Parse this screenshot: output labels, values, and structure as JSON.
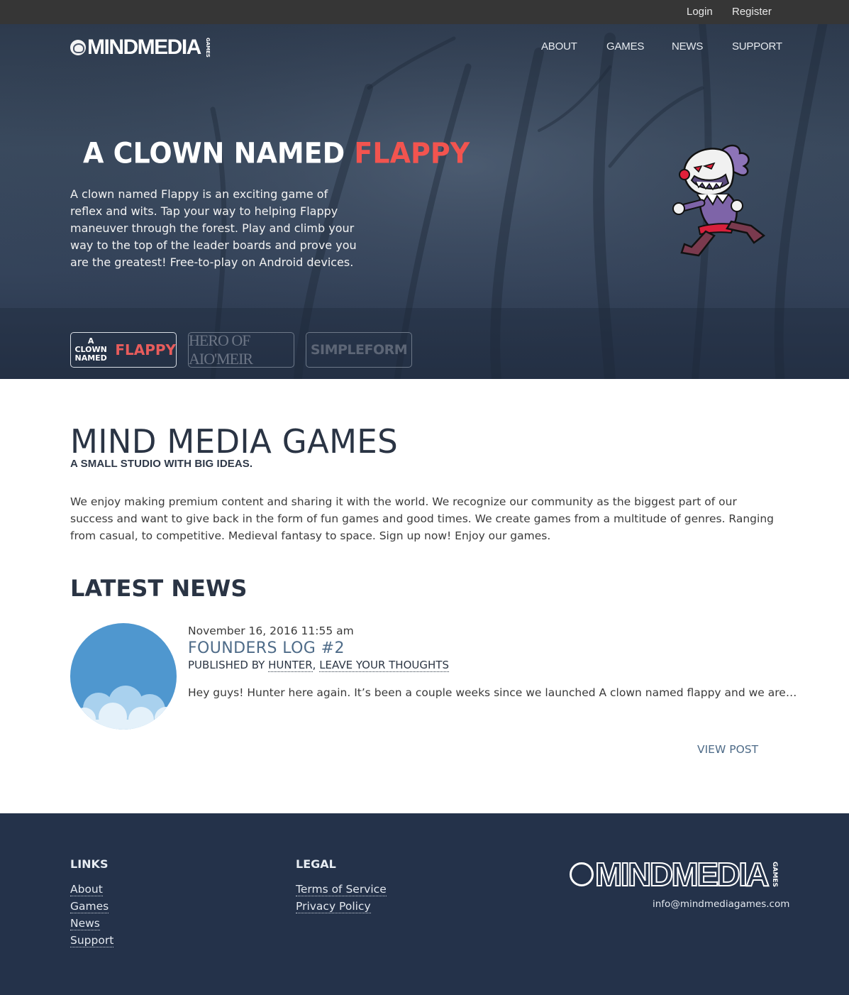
{
  "topbar": {
    "login": "Login",
    "register": "Register"
  },
  "brand": {
    "name": "MINDMEDIA",
    "suffix": "GAMES"
  },
  "nav": {
    "about": "ABOUT",
    "games": "GAMES",
    "news": "NEWS",
    "support": "SUPPORT"
  },
  "hero": {
    "title_main": "A CLOWN NAMED ",
    "title_accent": "FLAPPY",
    "description": "A clown named Flappy is an exciting game of reflex and wits. Tap your way to helping Flappy maneuver through the forest. Play and climb your way to the top of the leader boards and prove you are the greatest! Free-to-play on Android devices.",
    "thumbs": [
      {
        "line1": "A CLOWN",
        "line2": "NAMED",
        "accent": "FLAPPY",
        "active": true
      },
      {
        "label": "HERO OF AIO'MEIR",
        "active": false
      },
      {
        "label": "SIMPLEFORM",
        "active": false
      }
    ]
  },
  "studio": {
    "title": "MIND MEDIA GAMES",
    "subtitle": "A SMALL STUDIO WITH BIG IDEAS.",
    "description": "We enjoy making premium content and sharing it with the world. We recognize our community as the biggest part of our success and want to give back in the form of fun games and good times. We create games from a multitude of genres. Ranging from casual, to competitive. Medieval fantasy to space. Sign up now! Enjoy our games."
  },
  "news": {
    "heading": "LATEST NEWS",
    "post": {
      "date": "November 16, 2016 11:55 am",
      "title": "FOUNDERS LOG #2",
      "published_by": "PUBLISHED BY ",
      "author": "HUNTER",
      "separator": ", ",
      "comments": "LEAVE YOUR THOUGHTS",
      "excerpt": "Hey guys! Hunter here again. It’s been a couple weeks since we launched A clown named flappy and we are…",
      "view": "VIEW POST"
    }
  },
  "footer": {
    "links_heading": "LINKS",
    "links": [
      "About",
      "Games",
      "News",
      "Support"
    ],
    "legal_heading": "LEGAL",
    "legal": [
      "Terms of Service",
      "Privacy Policy"
    ],
    "email": "info@mindmediagames.com"
  },
  "colors": {
    "topbar": "#363636",
    "hero": "#34435a",
    "accent_red": "#f2544f",
    "link_blue": "#4e6b88",
    "footer": "#24324a"
  }
}
